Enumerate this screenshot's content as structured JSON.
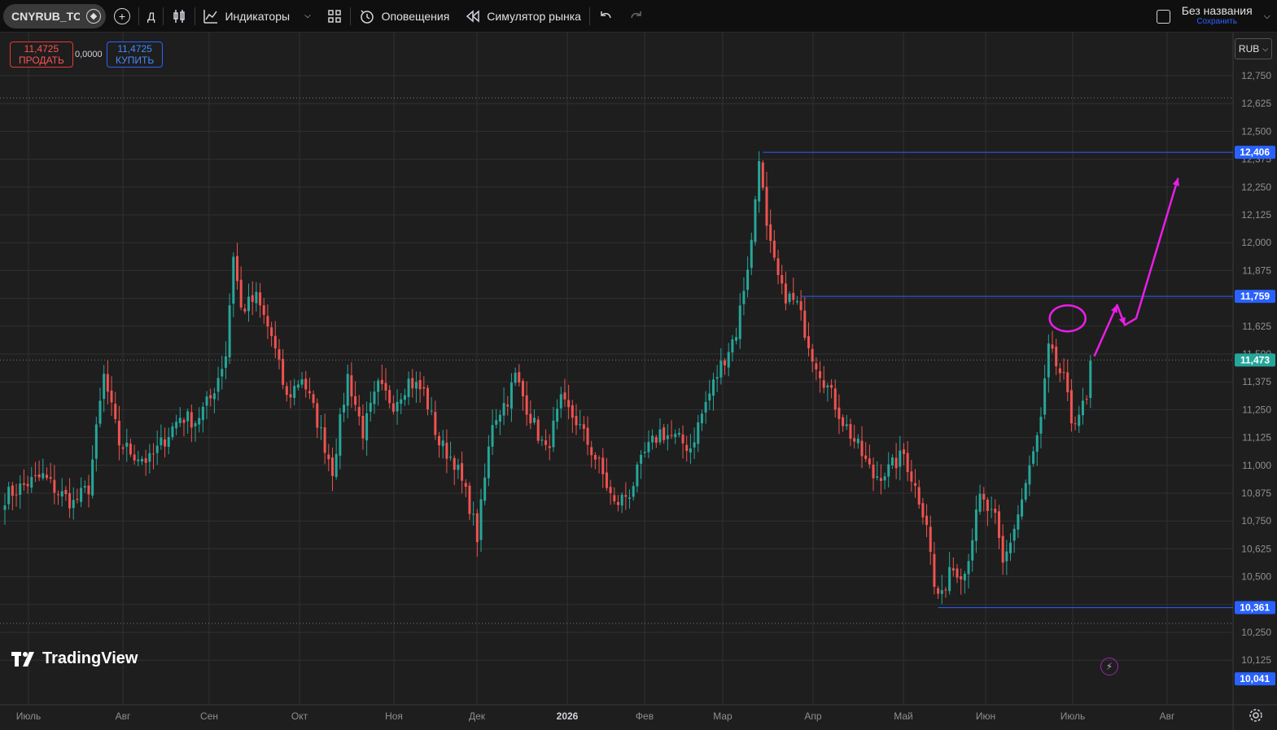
{
  "toolbar": {
    "symbol": "CNYRUB_TOM",
    "interval": "Д",
    "indicators_label": "Индикаторы",
    "alerts_label": "Оповещения",
    "replay_label": "Симулятор рынка",
    "layout_title": "Без названия",
    "save_label": "Сохранить"
  },
  "trade": {
    "sell_price": "11,4725",
    "sell_label": "ПРОДАТЬ",
    "spread": "0,0000",
    "buy_price": "11,4725",
    "buy_label": "КУПИТЬ"
  },
  "currency": "RUB",
  "logo_text": "TradingView",
  "colors": {
    "up": "#26a69a",
    "down": "#ef5350",
    "level": "#2962ff",
    "drawing": "#e91ee6",
    "bg": "#1e1e1e"
  },
  "chart_data": {
    "type": "candlestick",
    "ylim": [
      10.04,
      12.84
    ],
    "y_ticks": [
      "12,750",
      "12,625",
      "12,500",
      "12,375",
      "12,250",
      "12,125",
      "12,000",
      "11,875",
      "11,750",
      "11,625",
      "11,500",
      "11,375",
      "11,250",
      "11,125",
      "11,000",
      "10,875",
      "10,750",
      "10,625",
      "10,500",
      "10,375",
      "10,250",
      "10,125"
    ],
    "x_labels": [
      "Июль",
      "Авг",
      "Сен",
      "Окт",
      "Ноя",
      "Дек",
      "2026",
      "Фев",
      "Мар",
      "Апр",
      "Май",
      "Июн",
      "Июль",
      "Авг"
    ],
    "price_labels": [
      {
        "value": 12.406,
        "text": "12,406",
        "kind": "level"
      },
      {
        "value": 11.759,
        "text": "11,759",
        "kind": "level"
      },
      {
        "value": 11.473,
        "text": "11,473",
        "kind": "last"
      },
      {
        "value": 10.361,
        "text": "10,361",
        "kind": "level"
      },
      {
        "value": 10.041,
        "text": "10,041",
        "kind": "level"
      }
    ],
    "close_anchors": [
      [
        0,
        10.86
      ],
      [
        6,
        10.92
      ],
      [
        10,
        10.95
      ],
      [
        14,
        10.88
      ],
      [
        18,
        10.83
      ],
      [
        22,
        10.9
      ],
      [
        26,
        11.4
      ],
      [
        30,
        11.1
      ],
      [
        34,
        11.05
      ],
      [
        38,
        11.02
      ],
      [
        42,
        11.12
      ],
      [
        46,
        11.22
      ],
      [
        50,
        11.2
      ],
      [
        54,
        11.3
      ],
      [
        58,
        11.5
      ],
      [
        60,
        11.95
      ],
      [
        62,
        11.7
      ],
      [
        66,
        11.75
      ],
      [
        70,
        11.58
      ],
      [
        74,
        11.3
      ],
      [
        78,
        11.4
      ],
      [
        82,
        11.2
      ],
      [
        86,
        10.98
      ],
      [
        90,
        11.4
      ],
      [
        94,
        11.15
      ],
      [
        98,
        11.35
      ],
      [
        102,
        11.28
      ],
      [
        106,
        11.38
      ],
      [
        110,
        11.33
      ],
      [
        114,
        11.1
      ],
      [
        118,
        11.02
      ],
      [
        122,
        10.82
      ],
      [
        124,
        10.68
      ],
      [
        128,
        11.2
      ],
      [
        132,
        11.3
      ],
      [
        134,
        11.4
      ],
      [
        138,
        11.22
      ],
      [
        142,
        11.06
      ],
      [
        146,
        11.28
      ],
      [
        150,
        11.2
      ],
      [
        156,
        11.0
      ],
      [
        160,
        10.82
      ],
      [
        164,
        10.88
      ],
      [
        168,
        11.05
      ],
      [
        172,
        11.15
      ],
      [
        176,
        11.12
      ],
      [
        180,
        11.08
      ],
      [
        184,
        11.28
      ],
      [
        188,
        11.45
      ],
      [
        192,
        11.6
      ],
      [
        196,
        12.0
      ],
      [
        198,
        12.4
      ],
      [
        200,
        12.05
      ],
      [
        202,
        11.9
      ],
      [
        204,
        11.78
      ],
      [
        208,
        11.72
      ],
      [
        212,
        11.5
      ],
      [
        216,
        11.35
      ],
      [
        220,
        11.2
      ],
      [
        224,
        11.08
      ],
      [
        228,
        10.95
      ],
      [
        232,
        10.98
      ],
      [
        236,
        11.05
      ],
      [
        240,
        10.85
      ],
      [
        242,
        10.75
      ],
      [
        244,
        10.45
      ],
      [
        246,
        10.4
      ],
      [
        248,
        10.55
      ],
      [
        252,
        10.52
      ],
      [
        256,
        10.85
      ],
      [
        260,
        10.75
      ],
      [
        262,
        10.55
      ],
      [
        266,
        10.78
      ],
      [
        270,
        11.05
      ],
      [
        272,
        11.2
      ],
      [
        274,
        11.52
      ],
      [
        278,
        11.38
      ],
      [
        280,
        11.2
      ],
      [
        284,
        11.28
      ],
      [
        285,
        11.47
      ]
    ],
    "level_lines": [
      {
        "value": 12.406,
        "from_index": 199
      },
      {
        "value": 11.759,
        "from_index": 209
      },
      {
        "value": 10.361,
        "from_index": 245
      }
    ],
    "drawing_path_values": [
      {
        "index": 286,
        "value": 11.49
      },
      {
        "index": 292,
        "value": 11.72
      },
      {
        "index": 294,
        "value": 11.63
      },
      {
        "index": 297,
        "value": 11.66
      },
      {
        "index": 308,
        "value": 12.29
      }
    ]
  }
}
